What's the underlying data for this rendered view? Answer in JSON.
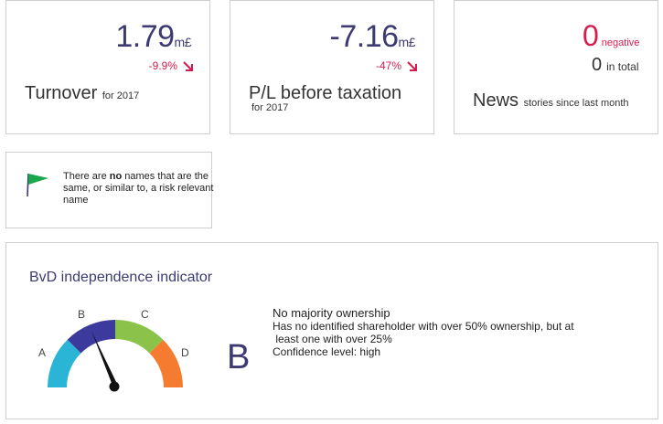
{
  "turnover": {
    "value": "1.79",
    "unit": "m£",
    "change": "-9.9%",
    "label": "Turnover",
    "sub": "for 2017"
  },
  "pl": {
    "value": "-7.16",
    "unit": "m£",
    "change": "-47%",
    "label": "P/L before taxation",
    "sub": "for 2017"
  },
  "news": {
    "negative_count": "0",
    "negative_label": "negative",
    "total_count": "0",
    "total_label": "in total",
    "label": "News",
    "sub": "stories since last month"
  },
  "names": {
    "text_before": "There are ",
    "text_bold": "no",
    "text_after": " names that are the same, or similar to, a risk relevant name",
    "flag_color": "#1aa64a"
  },
  "bvd": {
    "title": "BvD independence indicator",
    "grade": "B",
    "gauge_letters": [
      "A",
      "B",
      "C",
      "D"
    ],
    "gauge_colors": [
      "#2ab5d6",
      "#3d3a9e",
      "#8bc34a",
      "#f47b30"
    ],
    "selected_index": 1,
    "line1": "No majority ownership",
    "line2": "Has no identified shareholder with over 50% ownership, but at",
    "line3": " least one with over 25%",
    "line4": "Confidence level: high"
  },
  "colors": {
    "accent": "#3d3a73",
    "negative": "#d81b4e"
  }
}
